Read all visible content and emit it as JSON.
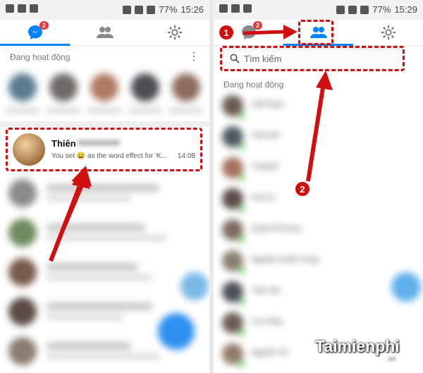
{
  "status_left": {
    "battery": "77%",
    "time": "15:26"
  },
  "status_right": {
    "battery": "77%",
    "time": "15:29"
  },
  "left": {
    "badge": "2",
    "section_active": "Đang hoạt động",
    "menu": "⋮",
    "chat": {
      "name": "Thiên",
      "message": "You set 😀 as the word effect for 'K...",
      "time": "14:08"
    }
  },
  "right": {
    "badge": "2",
    "search_placeholder": "Tìm kiếm",
    "section_active": "Đang hoạt động",
    "contacts": [
      "Việt Phạm",
      "Trần Anh",
      "Trang Bi",
      "Hoa Cu",
      "Quỳnh Phương",
      "Nguyễn Huyền Trang",
      "Trần Văn",
      "Cúc Khâu",
      "Nguyễn Thị"
    ]
  },
  "markers": {
    "one": "1",
    "two": "2"
  },
  "watermark": {
    "brand": "Taimienphi",
    "suffix": ".vn"
  },
  "colors": {
    "accent": "#0084ff",
    "annotation": "#d01010",
    "online": "#3ec43e"
  }
}
